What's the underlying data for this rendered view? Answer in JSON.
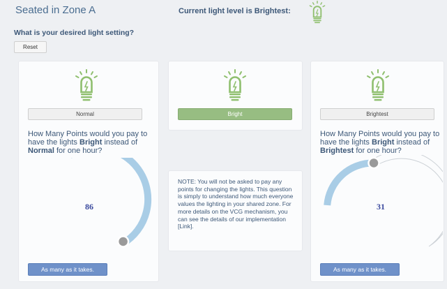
{
  "header": {
    "zone_title": "Seated in Zone A",
    "current_level_text": "Current light level is Brightest:"
  },
  "question": "What is your desired light setting?",
  "reset_label": "Reset",
  "options": [
    {
      "label": "Normal",
      "selected": false
    },
    {
      "label": "Bright",
      "selected": true
    },
    {
      "label": "Brightest",
      "selected": false
    }
  ],
  "left_panel": {
    "pay_prefix": "How Many Points would you pay to have the lights ",
    "pay_target": "Bright",
    "pay_mid": " instead of ",
    "pay_compare": "Normal",
    "pay_suffix": " for one hour?",
    "points": "86",
    "button_label": "As many as it takes."
  },
  "right_panel": {
    "pay_prefix": "How Many Points would you pay to have the lights ",
    "pay_target": "Bright",
    "pay_mid": " instead of ",
    "pay_compare": "Brightest",
    "pay_suffix": " for one hour?",
    "points": "31",
    "button_label": "As many as it takes."
  },
  "note": "NOTE: You will not be asked to pay any points for changing the lights. This question is simply to understand how much everyone values the lighting in your shared zone. For more details on the VCG mechanism, you can see the details of our implementation [Link].",
  "colors": {
    "bulb_green": "#8fbf6e",
    "gauge_fill": "#a9cde6",
    "selected_button": "#97bd82",
    "action_button": "#6f91c9"
  }
}
